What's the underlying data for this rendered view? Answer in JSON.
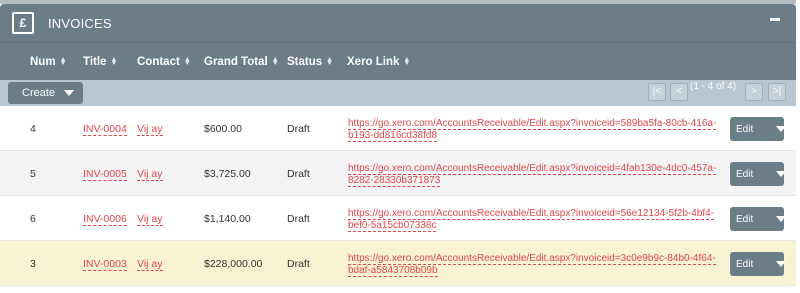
{
  "panel": {
    "icon": "pound-icon",
    "icon_glyph": "£",
    "title": "INVOICES"
  },
  "columns": [
    {
      "label": "Num"
    },
    {
      "label": "Title"
    },
    {
      "label": "Contact"
    },
    {
      "label": "Grand Total"
    },
    {
      "label": "Status"
    },
    {
      "label": "Xero Link"
    }
  ],
  "toolbar": {
    "create_label": "Create",
    "pager_count": "(1 - 4 of 4)",
    "first_label": "|<",
    "prev_label": "<",
    "next_label": ">",
    "last_label": ">|"
  },
  "rows": [
    {
      "num": "4",
      "title": "INV-0004",
      "contact": "Vij ay",
      "total": "$600.00",
      "status": "Draft",
      "xero": "https://go.xero.com/AccountsReceivable/Edit.aspx?invoiceid=589ba5fa-80cb-416a-b193-dd816cd38fd8",
      "edit": "Edit",
      "bg": "#ffffff"
    },
    {
      "num": "5",
      "title": "INV-0005",
      "contact": "Vij ay",
      "total": "$3,725.00",
      "status": "Draft",
      "xero": "https://go.xero.com/AccountsReceivable/Edit.aspx?invoiceid=4fab130e-4dc0-457a-8282-28330b371873",
      "edit": "Edit",
      "bg": "#f4f4f4"
    },
    {
      "num": "6",
      "title": "INV-0006",
      "contact": "Vij ay",
      "total": "$1,140.00",
      "status": "Draft",
      "xero": "https://go.xero.com/AccountsReceivable/Edit.aspx?invoiceid=56e12134-5f2b-4bf4-bef0-5a15cb07338c",
      "edit": "Edit",
      "bg": "#ffffff"
    },
    {
      "num": "3",
      "title": "INV-0003",
      "contact": "Vij ay",
      "total": "$228,000.00",
      "status": "Draft",
      "xero": "https://go.xero.com/AccountsReceivable/Edit.aspx?invoiceid=3c0e9b9c-84b0-4f64-bdaf-a5843708b09b",
      "edit": "Edit",
      "bg": "#f8f3d2"
    }
  ]
}
